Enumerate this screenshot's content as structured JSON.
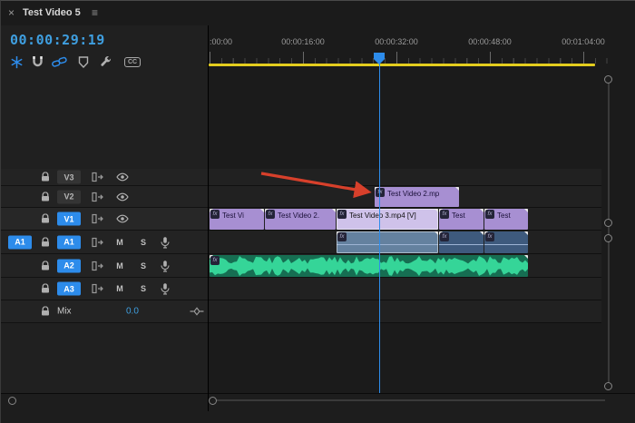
{
  "panel": {
    "close": "×",
    "title": "Test Video 5",
    "menu": "≡"
  },
  "timecode": "00:00:29:19",
  "icons": {
    "captions": "CC"
  },
  "ruler": {
    "labels": [
      ":00:00",
      "00:00:16:00",
      "00:00:32:00",
      "00:00:48:00",
      "00:01:04:00"
    ]
  },
  "tracks": {
    "v3": {
      "badge": "V3"
    },
    "v2": {
      "badge": "V2"
    },
    "v1": {
      "badge": "V1"
    },
    "a1": {
      "source": "A1",
      "badge": "A1",
      "mute": "M",
      "solo": "S"
    },
    "a2": {
      "badge": "A2",
      "mute": "M",
      "solo": "S"
    },
    "a3": {
      "badge": "A3",
      "mute": "M",
      "solo": "S"
    },
    "mix": {
      "label": "Mix",
      "value": "0.0"
    }
  },
  "clips": {
    "fx": "fx",
    "v2": [
      {
        "label": "Test Video 2.mp"
      }
    ],
    "v1": [
      {
        "label": "Test Vi"
      },
      {
        "label": "Test Video 2."
      },
      {
        "label": "Test Video 3.mp4 [V]"
      },
      {
        "label": "Test"
      },
      {
        "label": "Test"
      }
    ]
  },
  "colors": {
    "accent": "#2d8ceb",
    "timecode": "#3f9fe0",
    "clip": "#a78fd2",
    "clip_selected": "#cfc2ea",
    "audio_clip": "#3e5a7d",
    "audio_clip_selected": "#64819f",
    "green_clip": "#166e52",
    "waveform": "#35d598",
    "work_bar": "#e3cd1e",
    "arrow": "#d7402b"
  }
}
